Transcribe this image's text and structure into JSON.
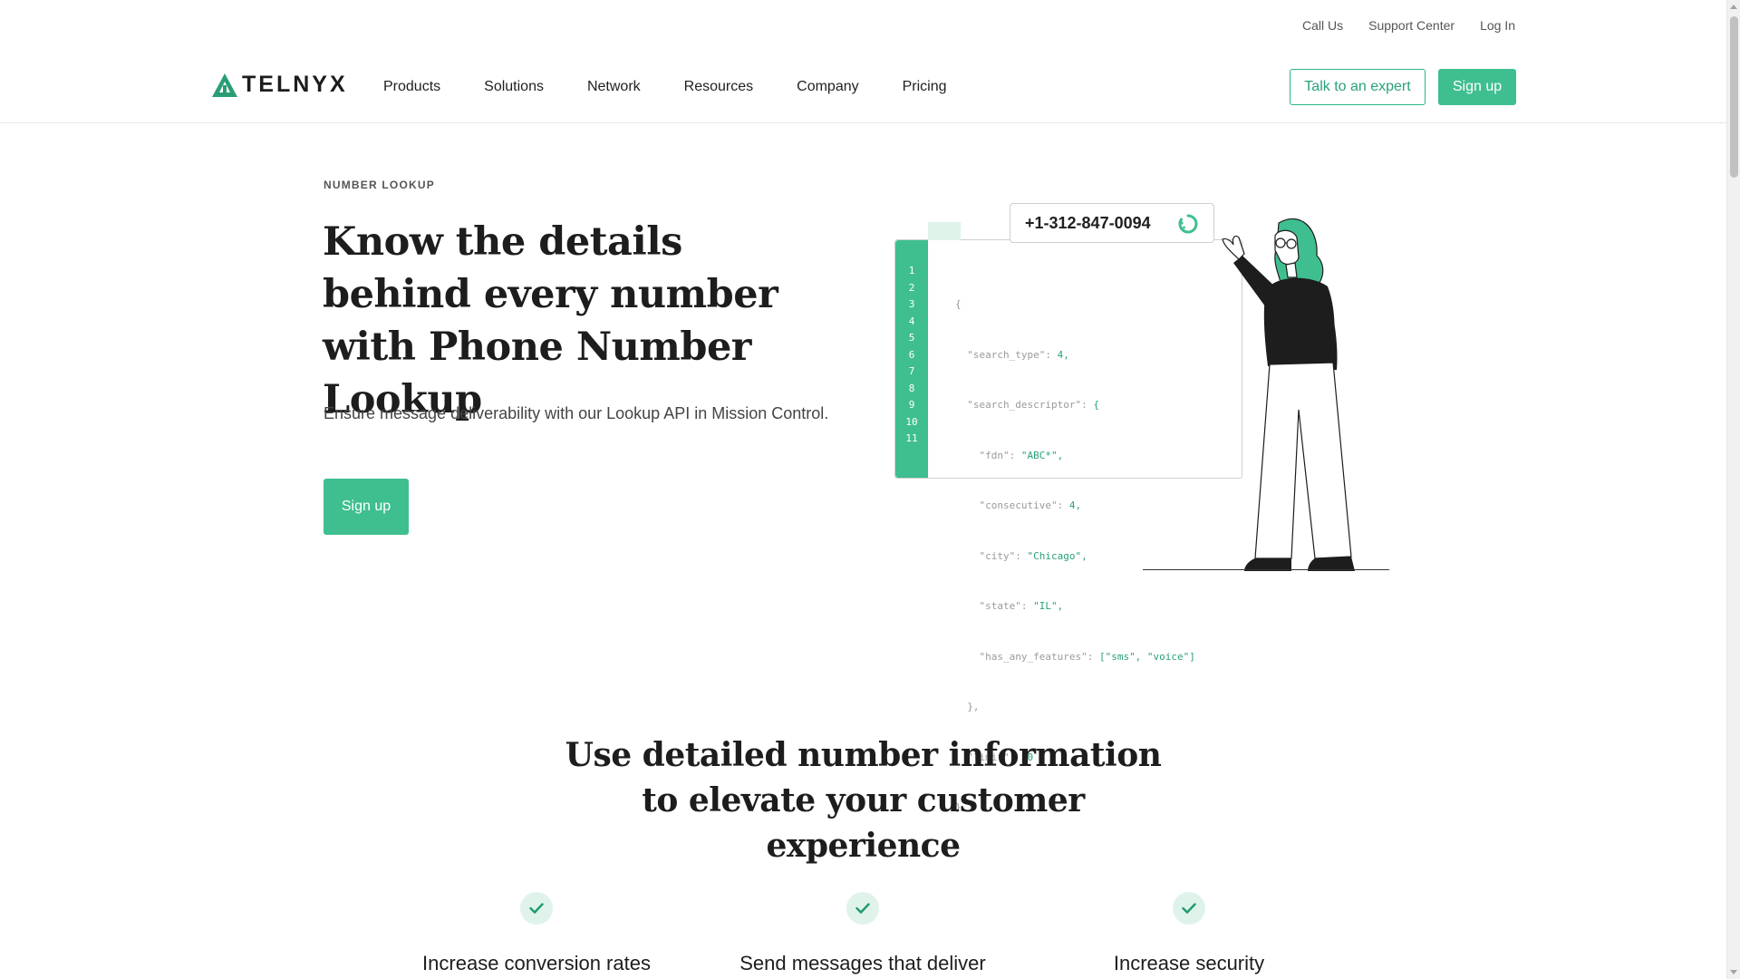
{
  "utility_nav": {
    "call_us": "Call Us",
    "support_center": "Support Center",
    "log_in": "Log In"
  },
  "brand": {
    "name": "TELNYX",
    "accent": "#3fbf8f"
  },
  "nav": {
    "items": [
      "Products",
      "Solutions",
      "Network",
      "Resources",
      "Company",
      "Pricing"
    ],
    "talk_to_expert": "Talk to an expert",
    "sign_up": "Sign up"
  },
  "hero": {
    "eyebrow": "NUMBER LOOKUP",
    "title": "Know the details behind every number with Phone Number Lookup",
    "subtitle": "Ensure message deliverability with our Lookup API in Mission Control.",
    "cta": "Sign up"
  },
  "illustration": {
    "phone_number": "+1-312-847-0094",
    "line_numbers": [
      "1",
      "2",
      "3",
      "4",
      "5",
      "6",
      "7",
      "8",
      "9",
      "10",
      "11"
    ],
    "code_lines": [
      "{",
      "  \"search_type\": 4,",
      "  \"search_descriptor\": {",
      "    \"fdn\": \"ABC*\",",
      "    \"consecutive\": 4,",
      "    \"city\": \"Chicago\",",
      "    \"state\": \"IL\",",
      "    \"has_any_features\": [\"sms\", \"voice\"]",
      "  },",
      "  \"limit\": 50",
      "}"
    ]
  },
  "section2": {
    "title": "Use detailed number information to elevate your customer experience",
    "features": [
      {
        "title": "Increase conversion rates",
        "icon": "check-icon"
      },
      {
        "title": "Send messages that deliver",
        "icon": "check-icon"
      },
      {
        "title": "Increase security",
        "icon": "check-icon"
      }
    ]
  }
}
